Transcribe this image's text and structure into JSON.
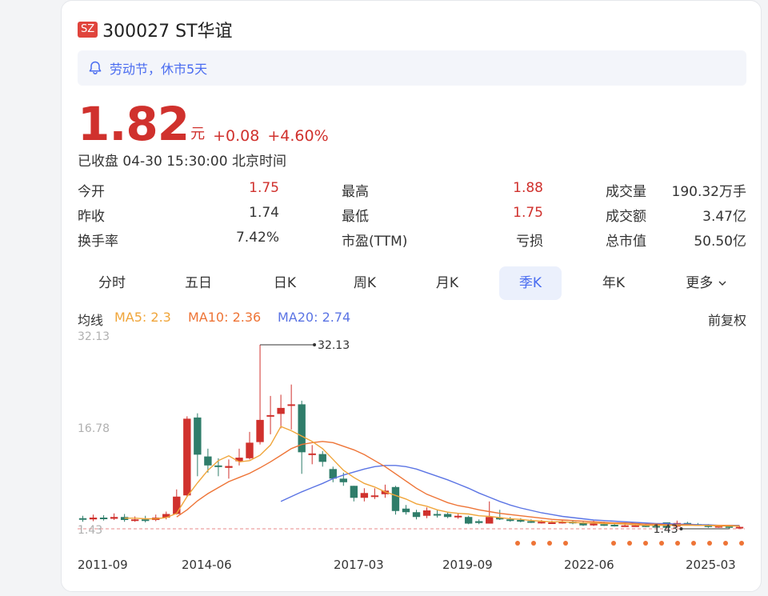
{
  "stock": {
    "exchange": "SZ",
    "title": "300027 ST华谊",
    "notice": "劳动节，休市5天",
    "price": "1.82",
    "unit": "元",
    "change": "+0.08",
    "change_pct": "+4.60%",
    "closed_status": "已收盘 04-30 15:30:00 北京时间"
  },
  "stats": [
    [
      {
        "label": "今开",
        "value": "1.75",
        "red": true
      },
      {
        "label": "最高",
        "value": "1.88",
        "red": true
      },
      {
        "label": "成交量",
        "value": "190.32万手",
        "red": false
      }
    ],
    [
      {
        "label": "昨收",
        "value": "1.74",
        "red": false
      },
      {
        "label": "最低",
        "value": "1.75",
        "red": true
      },
      {
        "label": "成交额",
        "value": "3.47亿",
        "red": false
      }
    ],
    [
      {
        "label": "换手率",
        "value": "7.42%",
        "red": false
      },
      {
        "label": "市盈(TTM)",
        "value": "亏损",
        "red": false
      },
      {
        "label": "总市值",
        "value": "50.50亿",
        "red": false
      }
    ]
  ],
  "tabs": [
    "分时",
    "五日",
    "日K",
    "周K",
    "月K",
    "季K",
    "年K",
    "更多"
  ],
  "active_tab": 5,
  "ma": {
    "label": "均线",
    "ma5": "MA5: 2.3",
    "ma10": "MA10: 2.36",
    "ma20": "MA20: 2.74",
    "adjust": "前复权"
  },
  "colors": {
    "up": "#d0312d",
    "down": "#2f7d6a",
    "ma5": "#f0a53a",
    "ma10": "#ee7436",
    "ma20": "#5b74e4",
    "accent": "#4a6cf0"
  },
  "chart_data": {
    "type": "candlestick",
    "y_ticks": [
      "32.13",
      "16.78",
      "1.43"
    ],
    "ylim": [
      1.43,
      32.13
    ],
    "x_ticks": [
      "2011-09",
      "2014-06",
      "2017-03",
      "2019-09",
      "2022-06",
      "2025-03"
    ],
    "annotations": [
      {
        "label": "32.13",
        "kind": "max"
      },
      {
        "label": "1.43",
        "kind": "min"
      }
    ],
    "candles": [
      {
        "o": 3.2,
        "c": 3.0,
        "h": 3.6,
        "l": 2.6
      },
      {
        "o": 3.0,
        "c": 3.3,
        "h": 3.8,
        "l": 2.7
      },
      {
        "o": 3.3,
        "c": 3.1,
        "h": 3.7,
        "l": 2.8
      },
      {
        "o": 3.1,
        "c": 3.4,
        "h": 4.0,
        "l": 2.9
      },
      {
        "o": 3.4,
        "c": 2.9,
        "h": 3.9,
        "l": 2.6
      },
      {
        "o": 2.9,
        "c": 3.0,
        "h": 3.5,
        "l": 2.6
      },
      {
        "o": 3.0,
        "c": 2.9,
        "h": 3.6,
        "l": 2.5
      },
      {
        "o": 2.9,
        "c": 3.3,
        "h": 3.8,
        "l": 2.7
      },
      {
        "o": 3.3,
        "c": 3.9,
        "h": 4.3,
        "l": 3.0
      },
      {
        "o": 3.9,
        "c": 6.8,
        "h": 8.0,
        "l": 3.8
      },
      {
        "o": 7.0,
        "c": 19.8,
        "h": 20.2,
        "l": 6.8
      },
      {
        "o": 20.0,
        "c": 13.8,
        "h": 20.7,
        "l": 10.2
      },
      {
        "o": 13.5,
        "c": 12.0,
        "h": 14.8,
        "l": 10.8
      },
      {
        "o": 12.0,
        "c": 11.8,
        "h": 13.2,
        "l": 10.2
      },
      {
        "o": 11.6,
        "c": 11.9,
        "h": 13.0,
        "l": 9.8
      },
      {
        "o": 12.7,
        "c": 13.3,
        "h": 14.8,
        "l": 12.0
      },
      {
        "o": 13.2,
        "c": 15.8,
        "h": 17.6,
        "l": 13.0
      },
      {
        "o": 15.9,
        "c": 19.6,
        "h": 32.13,
        "l": 15.5
      },
      {
        "o": 20.2,
        "c": 20.4,
        "h": 23.6,
        "l": 17.2
      },
      {
        "o": 20.6,
        "c": 21.6,
        "h": 23.8,
        "l": 18.2
      },
      {
        "o": 22.0,
        "c": 22.2,
        "h": 25.5,
        "l": 18.0
      },
      {
        "o": 22.2,
        "c": 14.2,
        "h": 22.8,
        "l": 10.6
      },
      {
        "o": 14.0,
        "c": 14.0,
        "h": 15.4,
        "l": 12.2
      },
      {
        "o": 13.9,
        "c": 12.6,
        "h": 14.4,
        "l": 11.8
      },
      {
        "o": 11.4,
        "c": 9.8,
        "h": 11.8,
        "l": 9.2
      },
      {
        "o": 9.8,
        "c": 9.2,
        "h": 10.8,
        "l": 8.6
      },
      {
        "o": 8.6,
        "c": 6.6,
        "h": 8.6,
        "l": 6.0
      },
      {
        "o": 6.6,
        "c": 7.4,
        "h": 8.2,
        "l": 6.0
      },
      {
        "o": 6.8,
        "c": 7.0,
        "h": 8.2,
        "l": 6.4
      },
      {
        "o": 7.2,
        "c": 7.8,
        "h": 8.8,
        "l": 6.6
      },
      {
        "o": 8.4,
        "c": 4.4,
        "h": 8.6,
        "l": 3.8
      },
      {
        "o": 4.8,
        "c": 4.2,
        "h": 5.4,
        "l": 3.8
      },
      {
        "o": 4.2,
        "c": 3.4,
        "h": 4.6,
        "l": 3.0
      },
      {
        "o": 3.6,
        "c": 4.5,
        "h": 5.0,
        "l": 3.2
      },
      {
        "o": 3.9,
        "c": 3.7,
        "h": 4.6,
        "l": 3.3
      },
      {
        "o": 3.9,
        "c": 3.4,
        "h": 4.2,
        "l": 3.2
      },
      {
        "o": 3.4,
        "c": 3.6,
        "h": 4.0,
        "l": 3.1
      },
      {
        "o": 3.4,
        "c": 2.3,
        "h": 3.6,
        "l": 2.2
      },
      {
        "o": 2.7,
        "c": 2.4,
        "h": 3.0,
        "l": 2.2
      },
      {
        "o": 2.3,
        "c": 3.4,
        "h": 6.0,
        "l": 2.3
      },
      {
        "o": 3.3,
        "c": 3.0,
        "h": 4.6,
        "l": 2.9
      },
      {
        "o": 3.0,
        "c": 2.8,
        "h": 3.4,
        "l": 2.6
      },
      {
        "o": 2.9,
        "c": 2.7,
        "h": 3.2,
        "l": 2.5
      },
      {
        "o": 2.7,
        "c": 2.6,
        "h": 3.0,
        "l": 2.4
      },
      {
        "o": 2.6,
        "c": 2.6,
        "h": 2.9,
        "l": 2.3
      },
      {
        "o": 2.5,
        "c": 2.5,
        "h": 2.8,
        "l": 2.3
      },
      {
        "o": 2.5,
        "c": 2.6,
        "h": 2.9,
        "l": 2.3
      },
      {
        "o": 2.6,
        "c": 2.4,
        "h": 2.9,
        "l": 2.2
      },
      {
        "o": 2.4,
        "c": 2.0,
        "h": 2.6,
        "l": 1.9
      },
      {
        "o": 2.0,
        "c": 2.3,
        "h": 2.8,
        "l": 1.9
      },
      {
        "o": 2.2,
        "c": 2.1,
        "h": 2.6,
        "l": 1.9
      },
      {
        "o": 2.1,
        "c": 2.0,
        "h": 2.3,
        "l": 1.8
      },
      {
        "o": 2.0,
        "c": 2.0,
        "h": 2.4,
        "l": 1.9
      },
      {
        "o": 1.9,
        "c": 2.0,
        "h": 2.2,
        "l": 1.8
      },
      {
        "o": 2.0,
        "c": 1.9,
        "h": 2.2,
        "l": 1.7
      },
      {
        "o": 1.9,
        "c": 1.8,
        "h": 2.1,
        "l": 1.7
      },
      {
        "o": 2.5,
        "c": 1.6,
        "h": 2.5,
        "l": 1.5
      },
      {
        "o": 1.8,
        "c": 2.4,
        "h": 2.8,
        "l": 1.6
      },
      {
        "o": 2.4,
        "c": 2.2,
        "h": 2.6,
        "l": 2.0
      },
      {
        "o": 2.2,
        "c": 2.0,
        "h": 2.4,
        "l": 1.9
      },
      {
        "o": 2.0,
        "c": 1.8,
        "h": 2.2,
        "l": 1.6
      },
      {
        "o": 1.8,
        "c": 1.9,
        "h": 2.1,
        "l": 1.6
      },
      {
        "o": 1.9,
        "c": 1.6,
        "h": 2.0,
        "l": 1.43
      },
      {
        "o": 1.6,
        "c": 1.75,
        "h": 1.9,
        "l": 1.5
      }
    ],
    "ma5": [
      null,
      null,
      null,
      null,
      3.2,
      3.2,
      3.1,
      3.1,
      3.3,
      4.0,
      6.8,
      9.1,
      11.2,
      12.8,
      13.6,
      12.6,
      12.8,
      13.7,
      15.4,
      18.5,
      17.8,
      16.9,
      16.0,
      14.8,
      13.0,
      11.2,
      10.0,
      9.0,
      8.4,
      7.6,
      7.0,
      6.4,
      5.6,
      5.2,
      4.6,
      4.2,
      4.0,
      3.9,
      3.6,
      3.5,
      3.3,
      3.1,
      3.0,
      2.8,
      2.7,
      2.6,
      2.6,
      2.5,
      2.4,
      2.4,
      2.3,
      2.3,
      2.2,
      2.1,
      2.0,
      2.0,
      2.0,
      2.0,
      2.0,
      2.0,
      2.0,
      1.9,
      1.9,
      1.9
    ],
    "ma10": [
      null,
      null,
      null,
      null,
      null,
      null,
      null,
      null,
      null,
      3.4,
      4.6,
      6.1,
      7.3,
      8.3,
      9.3,
      10.0,
      10.7,
      11.6,
      12.6,
      13.7,
      14.8,
      15.5,
      15.8,
      16.0,
      15.8,
      15.2,
      14.6,
      13.8,
      12.8,
      11.8,
      10.6,
      9.4,
      8.2,
      7.2,
      6.5,
      5.8,
      5.3,
      5.0,
      4.6,
      4.3,
      4.0,
      3.8,
      3.6,
      3.4,
      3.2,
      3.0,
      2.9,
      2.8,
      2.7,
      2.6,
      2.5,
      2.4,
      2.4,
      2.3,
      2.2,
      2.2,
      2.1,
      2.1,
      2.1,
      2.0,
      2.0,
      2.0,
      2.0,
      1.9
    ],
    "ma20": [
      null,
      null,
      null,
      null,
      null,
      null,
      null,
      null,
      null,
      null,
      null,
      null,
      null,
      null,
      null,
      null,
      null,
      null,
      null,
      6.0,
      6.8,
      7.6,
      8.3,
      9.0,
      9.8,
      10.4,
      10.9,
      11.4,
      11.8,
      12.0,
      12.0,
      11.8,
      11.4,
      10.8,
      10.2,
      9.6,
      8.9,
      8.2,
      7.4,
      6.7,
      6.0,
      5.4,
      4.9,
      4.5,
      4.1,
      3.8,
      3.5,
      3.3,
      3.1,
      2.9,
      2.8,
      2.7,
      2.6,
      2.5,
      2.4,
      2.3,
      2.3,
      2.2,
      2.2,
      2.1,
      2.1,
      2.0,
      2.0,
      2.0
    ]
  }
}
